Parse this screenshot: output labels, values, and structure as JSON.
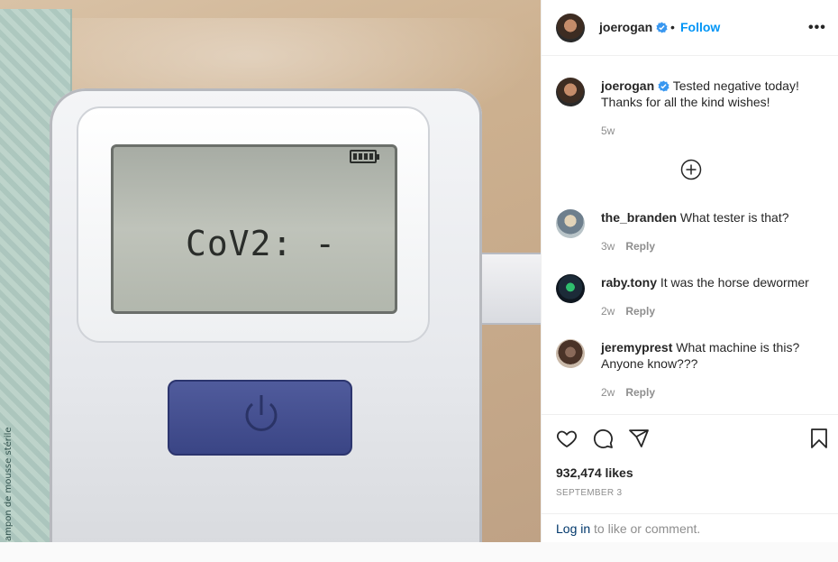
{
  "photo": {
    "lcd_text": "CoV2: -",
    "wrapper_text": "ampon de mousse stérile"
  },
  "header": {
    "username": "joerogan",
    "separator": "•",
    "follow_label": "Follow",
    "more_label": "•••"
  },
  "caption": {
    "username": "joerogan",
    "text": "Tested negative today! Thanks for all the kind wishes!",
    "time": "5w"
  },
  "comments": [
    {
      "username": "the_branden",
      "text": "What tester is that?",
      "time": "3w",
      "reply_label": "Reply"
    },
    {
      "username": "raby.tony",
      "text": "It was the horse dewormer",
      "time": "2w",
      "reply_label": "Reply"
    },
    {
      "username": "jeremyprest",
      "text": "What machine is this? Anyone know???",
      "time": "2w",
      "reply_label": "Reply"
    }
  ],
  "footer": {
    "likes": "932,474 likes",
    "date": "SEPTEMBER 3",
    "login_link": "Log in",
    "login_rest": " to like or comment."
  },
  "colors": {
    "link_blue": "#0095f6",
    "verified_blue": "#3897f0",
    "muted": "#8e8e8e",
    "text": "#262626"
  },
  "icons": [
    "heart-icon",
    "comment-icon",
    "share-icon",
    "bookmark-icon",
    "plus-circle-icon",
    "verified-icon",
    "power-icon"
  ]
}
